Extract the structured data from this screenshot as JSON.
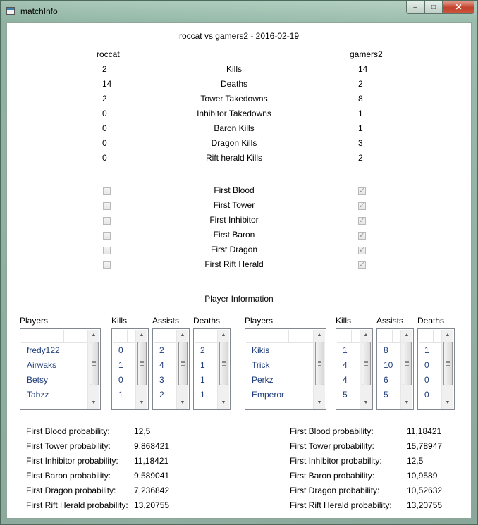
{
  "window": {
    "title": "matchInfo",
    "minimize_glyph": "–",
    "maximize_glyph": "□",
    "close_glyph": "✕"
  },
  "match": {
    "title": "roccat vs gamers2 - 2016-02-19",
    "team_left": "roccat",
    "team_right": "gamers2"
  },
  "stats": [
    {
      "label": "Kills",
      "left": "2",
      "right": "14"
    },
    {
      "label": "Deaths",
      "left": "14",
      "right": "2"
    },
    {
      "label": "Tower Takedowns",
      "left": "2",
      "right": "8"
    },
    {
      "label": "Inhibitor Takedowns",
      "left": "0",
      "right": "1"
    },
    {
      "label": "Baron Kills",
      "left": "0",
      "right": "1"
    },
    {
      "label": "Dragon Kills",
      "left": "0",
      "right": "3"
    },
    {
      "label": "Rift herald Kills",
      "left": "0",
      "right": "2"
    }
  ],
  "firsts": [
    {
      "label": "First Blood",
      "left_checked": false,
      "right_checked": true
    },
    {
      "label": "First Tower",
      "left_checked": false,
      "right_checked": true
    },
    {
      "label": "First Inhibitor",
      "left_checked": false,
      "right_checked": true
    },
    {
      "label": "First Baron",
      "left_checked": false,
      "right_checked": true
    },
    {
      "label": "First Dragon",
      "left_checked": false,
      "right_checked": true
    },
    {
      "label": "First Rift Herald",
      "left_checked": false,
      "right_checked": true
    }
  ],
  "player_info": {
    "title": "Player Information",
    "headers": {
      "players": "Players",
      "kills": "Kills",
      "assists": "Assists",
      "deaths": "Deaths"
    },
    "left": {
      "players": [
        "fredy122",
        "Airwaks",
        "Betsy",
        "Tabzz"
      ],
      "kills": [
        "0",
        "1",
        "0",
        "1"
      ],
      "assists": [
        "2",
        "4",
        "3",
        "2"
      ],
      "deaths": [
        "2",
        "1",
        "1",
        "1"
      ]
    },
    "right": {
      "players": [
        "Kikis",
        "Trick",
        "Perkz",
        "Emperor"
      ],
      "kills": [
        "1",
        "4",
        "4",
        "5"
      ],
      "assists": [
        "8",
        "10",
        "6",
        "5"
      ],
      "deaths": [
        "1",
        "0",
        "0",
        "0"
      ]
    }
  },
  "probabilities": {
    "left": [
      {
        "label": "First Blood probability:",
        "value": "12,5"
      },
      {
        "label": "First Tower probability:",
        "value": "9,868421"
      },
      {
        "label": "First Inhibitor probability:",
        "value": "11,18421"
      },
      {
        "label": "First Baron probability:",
        "value": "9,589041"
      },
      {
        "label": "First Dragon probability:",
        "value": "7,236842"
      },
      {
        "label": "First Rift Herald probability:",
        "value": "13,20755"
      }
    ],
    "right": [
      {
        "label": "First Blood probability:",
        "value": "11,18421"
      },
      {
        "label": "First Tower probability:",
        "value": "15,78947"
      },
      {
        "label": "First Inhibitor probability:",
        "value": "12,5"
      },
      {
        "label": "First Baron probability:",
        "value": "10,9589"
      },
      {
        "label": "First Dragon probability:",
        "value": "10,52632"
      },
      {
        "label": "First Rift Herald probability:",
        "value": "13,20755"
      }
    ]
  }
}
